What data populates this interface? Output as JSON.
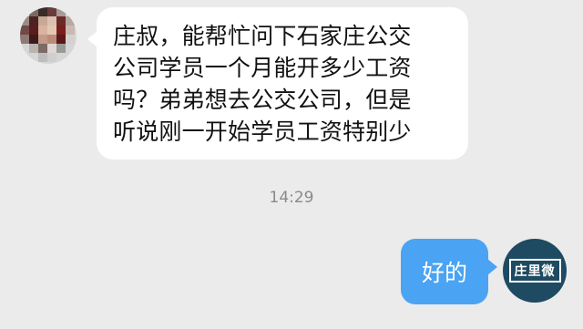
{
  "incoming": {
    "avatar_icon": "pixelated-user-avatar-icon",
    "lines": [
      "庄叔，能帮忙问下石家庄公交",
      "公司学员一个月能开多少工资",
      "吗？弟弟想去公交公司，但是",
      "听说刚一开始学员工资特别少"
    ]
  },
  "timestamp": "14:29",
  "outgoing": {
    "text": "好的",
    "avatar_logo_text": "庄里微",
    "avatar_icon": "brand-logo-avatar-icon"
  },
  "colors": {
    "background": "#ebebeb",
    "incoming_bubble": "#ffffff",
    "outgoing_bubble": "#4aa3f3",
    "brand_avatar": "#1e4a62"
  }
}
